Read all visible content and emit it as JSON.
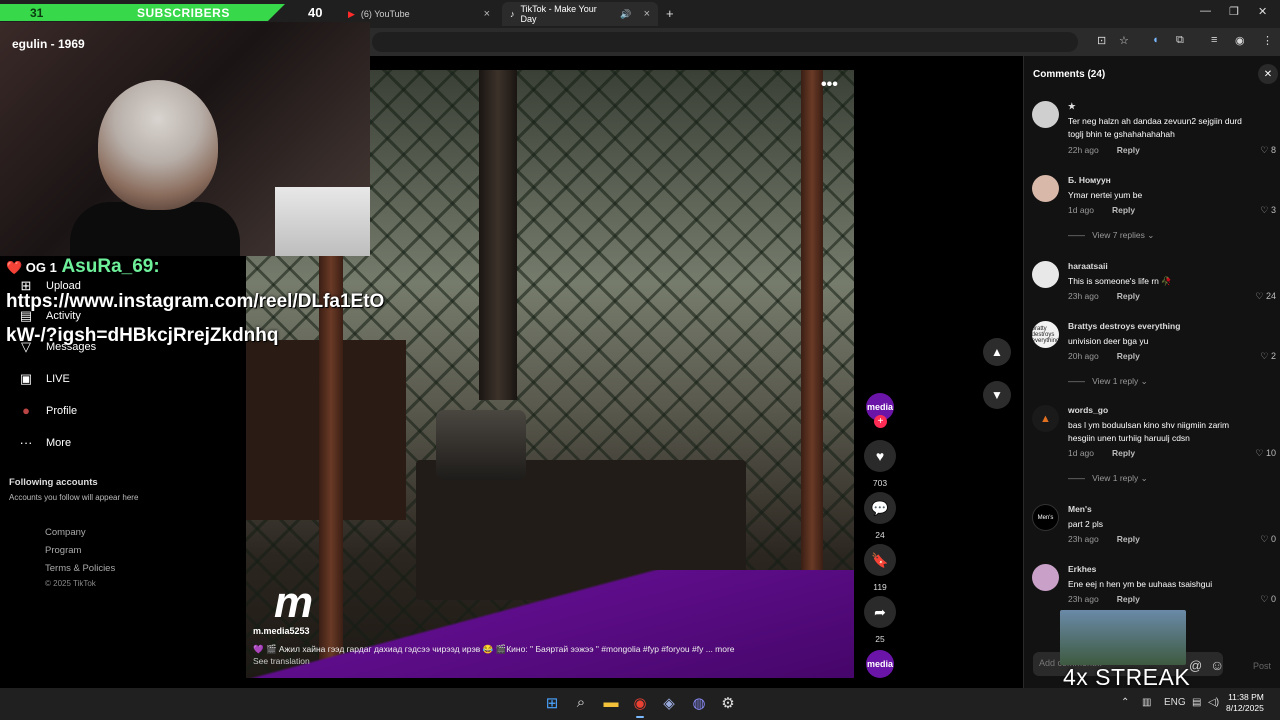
{
  "browser": {
    "tabs": [
      {
        "label": "(6) YouTube"
      },
      {
        "label": "TikTok - Make Your Day"
      }
    ],
    "new_tab": "+",
    "close": "×",
    "window": {
      "minimize": "—",
      "restore": "❐",
      "close": "✕"
    }
  },
  "overlay": {
    "subscribers_count": "31",
    "subscribers_label": "SUBSCRIBERS",
    "badge_count": "40",
    "streamer_name": "egulin - 1969",
    "chat": {
      "badges": "❤️ OG 1",
      "username": "AsuRa_69:",
      "message": "https://www.instagram.com/reel/DLfa1EtOkW-/?igsh=dHBkcjRrejZkdnhq"
    },
    "streak_text": "4x STREAK"
  },
  "nav": {
    "items": [
      {
        "label": "Upload",
        "icon": "upload-icon",
        "glyph": "⊞"
      },
      {
        "label": "Activity",
        "icon": "activity-icon",
        "glyph": "▤"
      },
      {
        "label": "Messages",
        "icon": "messages-icon",
        "glyph": "▽"
      },
      {
        "label": "LIVE",
        "icon": "live-icon",
        "glyph": "▣"
      },
      {
        "label": "Profile",
        "icon": "profile-icon",
        "glyph": "●"
      },
      {
        "label": "More",
        "icon": "more-icon",
        "glyph": "···"
      }
    ],
    "following_heading": "Following accounts",
    "following_text": "Accounts you follow will appear here",
    "footer_links": [
      "Company",
      "Program",
      "Terms & Policies"
    ],
    "copyright": "© 2025 TikTok"
  },
  "video": {
    "author": "m.media5253",
    "caption": "💜 🎬 Ажил хайна гээд гардаг дахиад гэдсээ чирээд ирэв 😂 🎬Кино: \" Баяртай ээжээ \" #mongolia #fyp #foryou #fy ... more",
    "see_translation": "See translation",
    "logo": "m",
    "more_glyph": "•••"
  },
  "actions": {
    "likes": "703",
    "comments": "24",
    "saves": "119",
    "shares": "25",
    "avatar_label": "media"
  },
  "comments": {
    "title": "Comments (24)",
    "items": [
      {
        "user": "★",
        "text": "Ter neg halzn ah dandaa zevuun2 sejgiin durd toglj bhin te gshahahahahah",
        "time": "22h ago",
        "reply": "Reply",
        "likes": "8"
      },
      {
        "user": "Б. Номуун",
        "text": "Ymar nertei yum be",
        "time": "1d ago",
        "reply": "Reply",
        "likes": "3",
        "view_replies": "View 7 replies"
      },
      {
        "user": "haraatsaii",
        "text": "This is someone's life rn 🥀",
        "time": "23h ago",
        "reply": "Reply",
        "likes": "24"
      },
      {
        "user": "Brattys destroys everything",
        "text": "univision deer bga yu",
        "time": "20h ago",
        "reply": "Reply",
        "likes": "2",
        "view_replies": "View 1 reply",
        "avatar_text": "bratty destroys everything"
      },
      {
        "user": "words_go",
        "text": "bas l ym boduulsan kino shv niigmiin zarim hesgiin unen turhiig haruulj cdsn",
        "time": "1d ago",
        "reply": "Reply",
        "likes": "10",
        "view_replies": "View 1 reply"
      },
      {
        "user": "Men's",
        "text": "part 2 pls",
        "time": "23h ago",
        "reply": "Reply",
        "likes": "0",
        "avatar_text": "Men's"
      },
      {
        "user": "Erkhes",
        "text": "Ene eej n hen ym be uuhaas tsaishgui",
        "time": "23h ago",
        "reply": "Reply",
        "likes": "0"
      }
    ],
    "input_placeholder": "Add comment...",
    "post_label": "Post"
  },
  "taskbar": {
    "language": "ENG",
    "time": "11:38 PM",
    "date": "8/12/2025"
  },
  "colors": {
    "accent_green": "#37d84a",
    "tiktok_red": "#fe2c55",
    "media_purple": "#6b14a8"
  }
}
